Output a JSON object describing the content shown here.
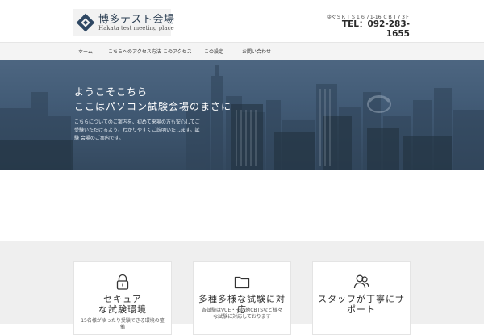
{
  "header": {
    "logo_title": "博多テスト会場",
    "logo_subtitle": "Hakata test meeting place",
    "address": "ゆぐＳＫＴＳ１６７1-16 ＣＢＴ7 3Ｆ",
    "tel": "TEL：092-283-1655"
  },
  "nav": {
    "items": [
      "ホーム",
      "こちらへのアクセス方法",
      "このアクセス",
      "この設定",
      "お問い合わせ"
    ]
  },
  "hero": {
    "title_line1": "ようこそこちら",
    "title_line2": "ここはパソコン試験会場のまさに",
    "description": "こちらについてのご案内を、初めて来場の方も安心してご受験いただけるよう、わかりやすくご説明いたします。試験 会場のご案内です。"
  },
  "cards": [
    {
      "icon": "lock-icon",
      "title_line1": "セキュア",
      "title_line2": "な試験環境",
      "text": "15名様がゆったり受験できる環境の整備"
    },
    {
      "icon": "folder-icon",
      "title_line1": "多種多様な試験に対応",
      "title_line2": "",
      "text": "各試験はVUE・その他CBTSなど様々な試験に対応しております"
    },
    {
      "icon": "users-icon",
      "title_line1": "スタッフが丁寧にサポート",
      "title_line2": "",
      "text": ""
    }
  ]
}
